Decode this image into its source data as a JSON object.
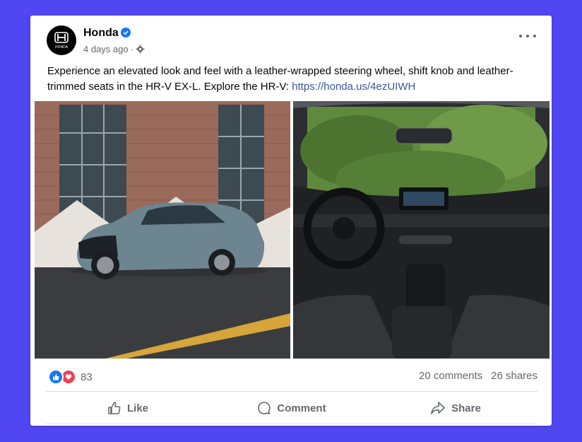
{
  "post": {
    "page_name": "Honda",
    "time": "4 days ago",
    "separator": "·",
    "text": "Experience an elevated look and feel with a leather-wrapped steering wheel, shift knob and leather-trimmed seats in the HR-V EX-L. Explore the HR-V: ",
    "link": "https://honda.us/4ezUIWH",
    "avatar_text": "HONDA"
  },
  "stats": {
    "reaction_count": "83",
    "comments": "20 comments",
    "shares": "26 shares"
  },
  "actions": {
    "like": "Like",
    "comment": "Comment",
    "share": "Share"
  },
  "colors": {
    "background": "#5147f2",
    "link": "#385898",
    "like_blue": "#1877f2",
    "love_red": "#f33e58",
    "verified": "#1877f2"
  },
  "icons": [
    "verified-badge-icon",
    "globe-settings-icon",
    "more-options-icon",
    "like-reaction-icon",
    "love-reaction-icon",
    "thumbs-up-icon",
    "comment-icon",
    "share-icon"
  ]
}
